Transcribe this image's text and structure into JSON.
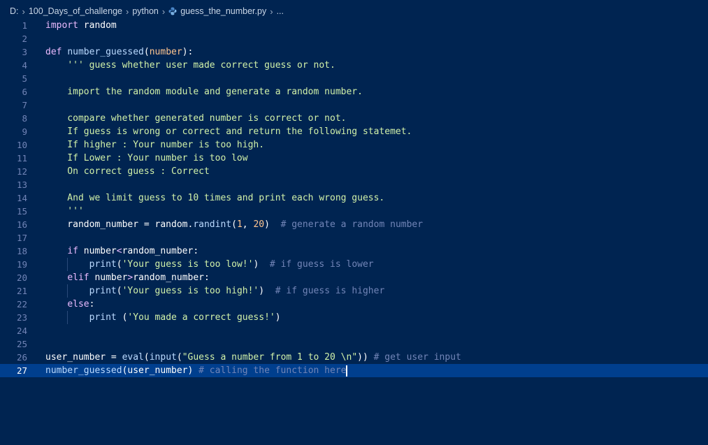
{
  "breadcrumb": {
    "drive": "D:",
    "folder1": "100_Days_of_challenge",
    "folder2": "python",
    "file": "guess_the_number.py",
    "more": "..."
  },
  "icons": {
    "separator": "chevron-right-icon",
    "file": "python-file-icon"
  },
  "colors": {
    "background": "#002451",
    "current_line": "#003f8e",
    "keyword": "#ebbbff",
    "function": "#bbdaff",
    "string": "#d1f1a9",
    "number": "#ffc58f",
    "comment": "#7285b7"
  },
  "current_line": 27,
  "lines": [
    {
      "n": "1",
      "t": [
        [
          "kw",
          "import"
        ],
        [
          "pl",
          " random"
        ]
      ]
    },
    {
      "n": "2",
      "t": []
    },
    {
      "n": "3",
      "t": [
        [
          "kw",
          "def"
        ],
        [
          "pl",
          " "
        ],
        [
          "fn",
          "number_guessed"
        ],
        [
          "pl",
          "("
        ],
        [
          "param",
          "number"
        ],
        [
          "pl",
          "):"
        ]
      ]
    },
    {
      "n": "4",
      "t": [
        [
          "pl",
          "    "
        ],
        [
          "str",
          "''' guess whether user made correct guess or not."
        ]
      ]
    },
    {
      "n": "5",
      "t": []
    },
    {
      "n": "6",
      "t": [
        [
          "str",
          "    import the random module and generate a random number."
        ]
      ]
    },
    {
      "n": "7",
      "t": []
    },
    {
      "n": "8",
      "t": [
        [
          "str",
          "    compare whether generated number is correct or not."
        ]
      ]
    },
    {
      "n": "9",
      "t": [
        [
          "str",
          "    If guess is wrong or correct and return the following statemet."
        ]
      ]
    },
    {
      "n": "10",
      "t": [
        [
          "str",
          "    If higher : Your number is too high."
        ]
      ]
    },
    {
      "n": "11",
      "t": [
        [
          "str",
          "    If Lower : Your number is too low"
        ]
      ]
    },
    {
      "n": "12",
      "t": [
        [
          "str",
          "    On correct guess : Correct"
        ]
      ]
    },
    {
      "n": "13",
      "t": []
    },
    {
      "n": "14",
      "t": [
        [
          "str",
          "    And we limit guess to 10 times and print each wrong guess."
        ]
      ]
    },
    {
      "n": "15",
      "t": [
        [
          "str",
          "    '''"
        ]
      ]
    },
    {
      "n": "16",
      "t": [
        [
          "pl",
          "    random_number = random."
        ],
        [
          "fn",
          "randint"
        ],
        [
          "pl",
          "("
        ],
        [
          "num",
          "1"
        ],
        [
          "pl",
          ", "
        ],
        [
          "num",
          "20"
        ],
        [
          "pl",
          ")  "
        ],
        [
          "cm",
          "# generate a random number"
        ]
      ]
    },
    {
      "n": "17",
      "t": []
    },
    {
      "n": "18",
      "t": [
        [
          "pl",
          "    "
        ],
        [
          "kw",
          "if"
        ],
        [
          "pl",
          " number"
        ],
        [
          "kw",
          "<"
        ],
        [
          "pl",
          "random_number:"
        ]
      ]
    },
    {
      "n": "19",
      "t": [
        [
          "pl",
          "        "
        ],
        [
          "fn",
          "print"
        ],
        [
          "pl",
          "("
        ],
        [
          "str",
          "'Your guess is too low!'"
        ],
        [
          "pl",
          ")  "
        ],
        [
          "cm",
          "# if guess is lower"
        ]
      ]
    },
    {
      "n": "20",
      "t": [
        [
          "pl",
          "    "
        ],
        [
          "kw",
          "elif"
        ],
        [
          "pl",
          " number"
        ],
        [
          "kw",
          ">"
        ],
        [
          "pl",
          "random_number:"
        ]
      ]
    },
    {
      "n": "21",
      "t": [
        [
          "pl",
          "        "
        ],
        [
          "fn",
          "print"
        ],
        [
          "pl",
          "("
        ],
        [
          "str",
          "'Your guess is too high!'"
        ],
        [
          "pl",
          ")  "
        ],
        [
          "cm",
          "# if guess is higher"
        ]
      ]
    },
    {
      "n": "22",
      "t": [
        [
          "pl",
          "    "
        ],
        [
          "kw",
          "else"
        ],
        [
          "pl",
          ":"
        ]
      ]
    },
    {
      "n": "23",
      "t": [
        [
          "pl",
          "        "
        ],
        [
          "fn",
          "print"
        ],
        [
          "pl",
          " ("
        ],
        [
          "str",
          "'You made a correct guess!'"
        ],
        [
          "pl",
          ")"
        ]
      ]
    },
    {
      "n": "24",
      "t": []
    },
    {
      "n": "25",
      "t": []
    },
    {
      "n": "26",
      "t": [
        [
          "pl",
          "user_number = "
        ],
        [
          "fn",
          "eval"
        ],
        [
          "pl",
          "("
        ],
        [
          "fn",
          "input"
        ],
        [
          "pl",
          "("
        ],
        [
          "str",
          "\"Guess a number from 1 to 20 \\n\""
        ],
        [
          "pl",
          "))"
        ],
        [
          "pl",
          " "
        ],
        [
          "cm",
          "# get user input"
        ]
      ]
    },
    {
      "n": "27",
      "t": [
        [
          "fn",
          "number_guessed"
        ],
        [
          "pl",
          "(user_number) "
        ],
        [
          "cm",
          "# calling the function here"
        ]
      ]
    }
  ]
}
